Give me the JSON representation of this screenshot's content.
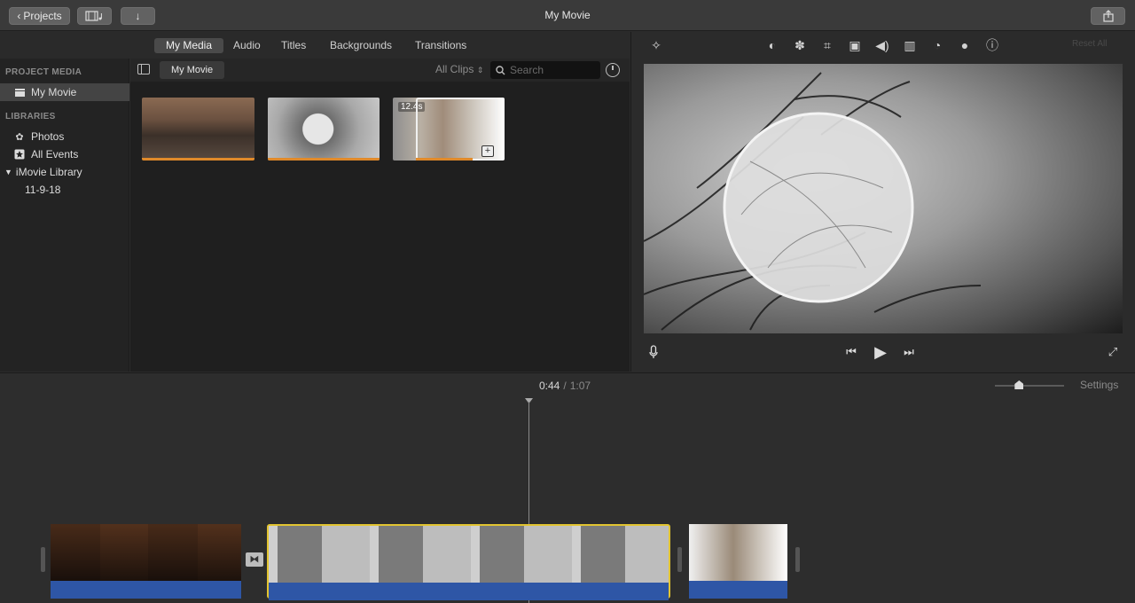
{
  "window": {
    "title": "My Movie",
    "projects_label": "Projects",
    "media_icon": "film-music-icon",
    "import_icon": "download-arrow-icon",
    "share_icon": "share-icon"
  },
  "tabs": [
    {
      "label": "My Media",
      "active": true
    },
    {
      "label": "Audio",
      "active": false
    },
    {
      "label": "Titles",
      "active": false
    },
    {
      "label": "Backgrounds",
      "active": false
    },
    {
      "label": "Transitions",
      "active": false
    }
  ],
  "sidebar": {
    "project_media_header": "PROJECT MEDIA",
    "project_item": "My Movie",
    "libraries_header": "LIBRARIES",
    "items": [
      {
        "label": "Photos",
        "icon": "photos-icon"
      },
      {
        "label": "All Events",
        "icon": "star-icon"
      },
      {
        "label": "iMovie Library",
        "icon": "disclosure-triangle-icon"
      },
      {
        "label": "11-9-18",
        "icon": ""
      }
    ]
  },
  "browser": {
    "title": "My Movie",
    "filter": "All Clips",
    "search_placeholder": "Search",
    "clips": [
      {
        "id": "clip-1",
        "duration": ""
      },
      {
        "id": "clip-2",
        "duration": ""
      },
      {
        "id": "clip-3",
        "duration": "12.4s"
      }
    ],
    "clip3_add": "+"
  },
  "viewer": {
    "tools": [
      "magic-wand-icon",
      "color-balance-icon",
      "color-palette-icon",
      "crop-icon",
      "stabilization-camera-icon",
      "volume-icon",
      "equalizer-icon",
      "speed-icon",
      "clip-filter-icon",
      "info-icon"
    ],
    "reset_label": "Reset All",
    "controls": {
      "voiceover": "microphone-icon",
      "prev": "skip-back-icon",
      "play": "play-icon",
      "next": "skip-forward-icon",
      "fullscreen": "fullscreen-icon"
    }
  },
  "timeline": {
    "current_time": "0:44",
    "separator": "/",
    "total_time": "1:07",
    "zoom_level": 0.35,
    "settings_label": "Settings",
    "transition_icon": "cross-dissolve-icon",
    "clips": [
      {
        "id": "tl-clip-1",
        "selected": false
      },
      {
        "id": "tl-clip-2",
        "selected": true
      },
      {
        "id": "tl-clip-3",
        "selected": false
      }
    ]
  },
  "colors": {
    "accent_selected": "#e2c430",
    "audio_track": "#2e56a6",
    "clip_used_bar": "#e08a2a"
  }
}
